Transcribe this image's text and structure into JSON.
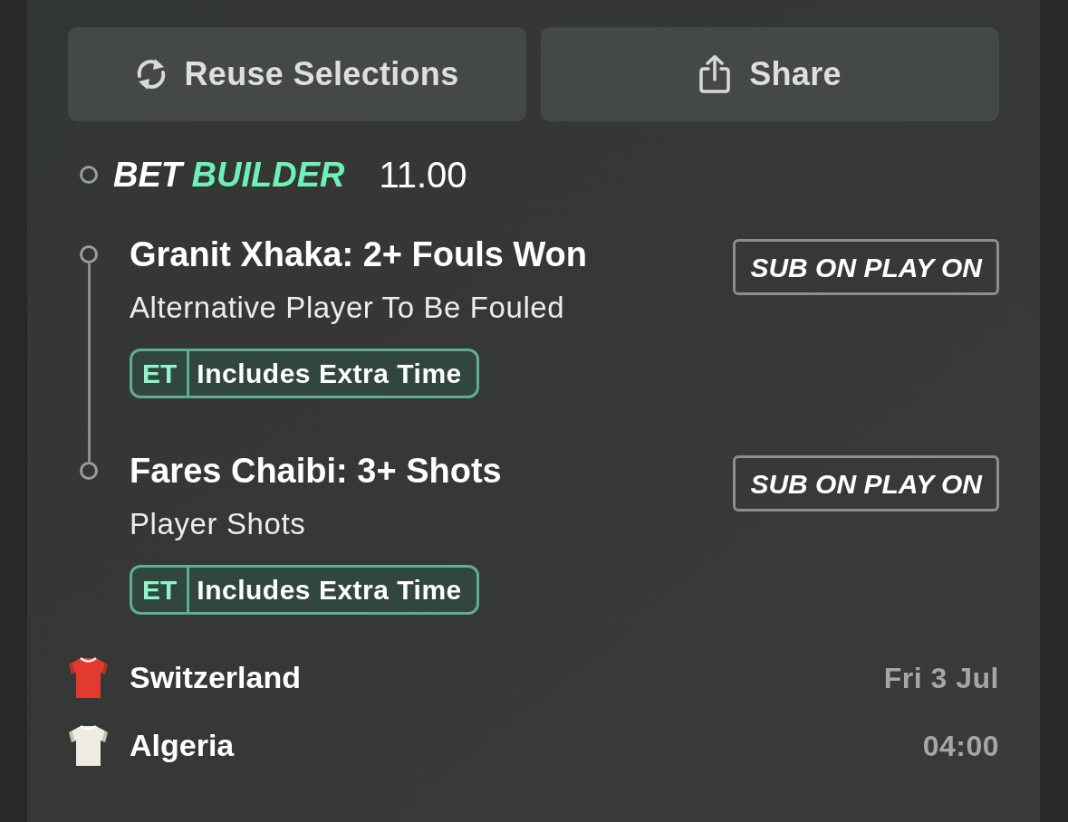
{
  "actions": [
    {
      "kind": "reuse",
      "label": "Reuse Selections"
    },
    {
      "kind": "share",
      "label": "Share"
    }
  ],
  "bet_builder": {
    "title_parts": [
      "BET",
      "BUILDER"
    ],
    "odds": "11.00"
  },
  "legs": [
    {
      "title": "Granit Xhaka: 2+ Fouls Won",
      "market": "Alternative Player To Be Fouled",
      "badge_code": "ET",
      "badge_label": "Includes Extra Time",
      "tag": "SUB ON PLAY ON"
    },
    {
      "title": "Fares Chaibi: 3+ Shots",
      "market": "Player Shots",
      "badge_code": "ET",
      "badge_label": "Includes Extra Time",
      "tag": "SUB ON PLAY ON"
    }
  ],
  "match": {
    "teams": [
      {
        "name": "Switzerland",
        "color": "#e23a2e"
      },
      {
        "name": "Algeria",
        "color": "#eeebe3"
      }
    ],
    "date": "Fri 3 Jul",
    "time": "04:00"
  }
}
